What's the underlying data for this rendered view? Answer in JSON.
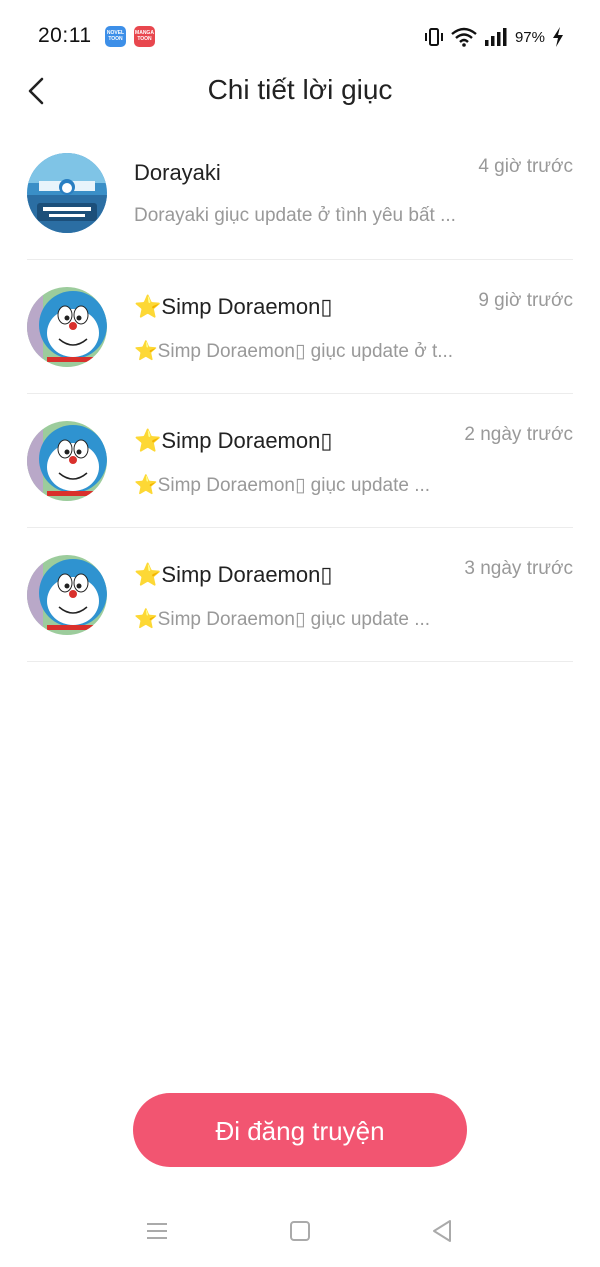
{
  "status_bar": {
    "time": "20:11",
    "apps": [
      "NOVEL TOON",
      "MANGA TOON"
    ],
    "battery": "97%"
  },
  "header": {
    "title": "Chi tiết lời giục"
  },
  "items": [
    {
      "name": "Dorayaki",
      "time": "4 giờ trước",
      "preview": "Dorayaki giục update ở tình yêu bất ...",
      "avatar": "dorayaki-avatar"
    },
    {
      "star": "⭐",
      "name": "Simp Doraemon▯",
      "time": "9 giờ trước",
      "preview_star": "⭐",
      "preview": "Simp Doraemon▯ giục update ở t...",
      "avatar": "doraemon-avatar"
    },
    {
      "star": "⭐",
      "name": "Simp Doraemon▯",
      "time": "2 ngày trước",
      "preview_star": "⭐",
      "preview": "Simp Doraemon▯ giục update ...",
      "avatar": "doraemon-avatar"
    },
    {
      "star": "⭐",
      "name": "Simp Doraemon▯",
      "time": "3 ngày trước",
      "preview_star": "⭐",
      "preview": "Simp Doraemon▯ giục update ...",
      "avatar": "doraemon-avatar"
    }
  ],
  "cta": {
    "label": "Đi đăng truyện"
  },
  "colors": {
    "accent": "#f25571",
    "muted": "#999999",
    "star": "#f7c31a"
  },
  "nav": {
    "icons": [
      "menu-icon",
      "home-square-icon",
      "back-triangle-icon"
    ]
  }
}
